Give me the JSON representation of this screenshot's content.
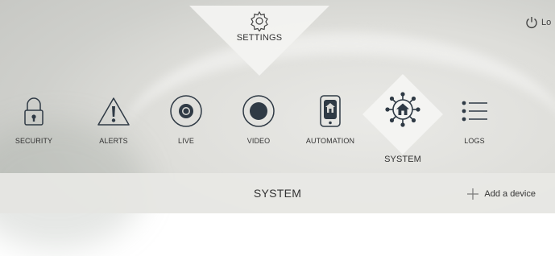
{
  "header": {
    "settings_label": "SETTINGS",
    "logout_label": "Lo",
    "settings_icon": "gear-icon",
    "logout_icon": "power-icon"
  },
  "nav": {
    "items": [
      {
        "label": "SECURITY",
        "icon": "lock-icon"
      },
      {
        "label": "ALERTS",
        "icon": "alert-triangle-icon"
      },
      {
        "label": "LIVE",
        "icon": "live-camera-icon"
      },
      {
        "label": "VIDEO",
        "icon": "record-icon"
      },
      {
        "label": "AUTOMATION",
        "icon": "automation-device-icon"
      },
      {
        "label": "SYSTEM",
        "icon": "system-network-home-icon",
        "active": true
      },
      {
        "label": "LOGS",
        "icon": "list-icon"
      }
    ]
  },
  "bottom_bar": {
    "title": "SYSTEM",
    "add_device_label": "Add a device",
    "add_icon": "plus-icon"
  },
  "colors": {
    "icon_dark": "#2f3a45",
    "diamond": "#f4f4f2",
    "text": "#333333"
  }
}
